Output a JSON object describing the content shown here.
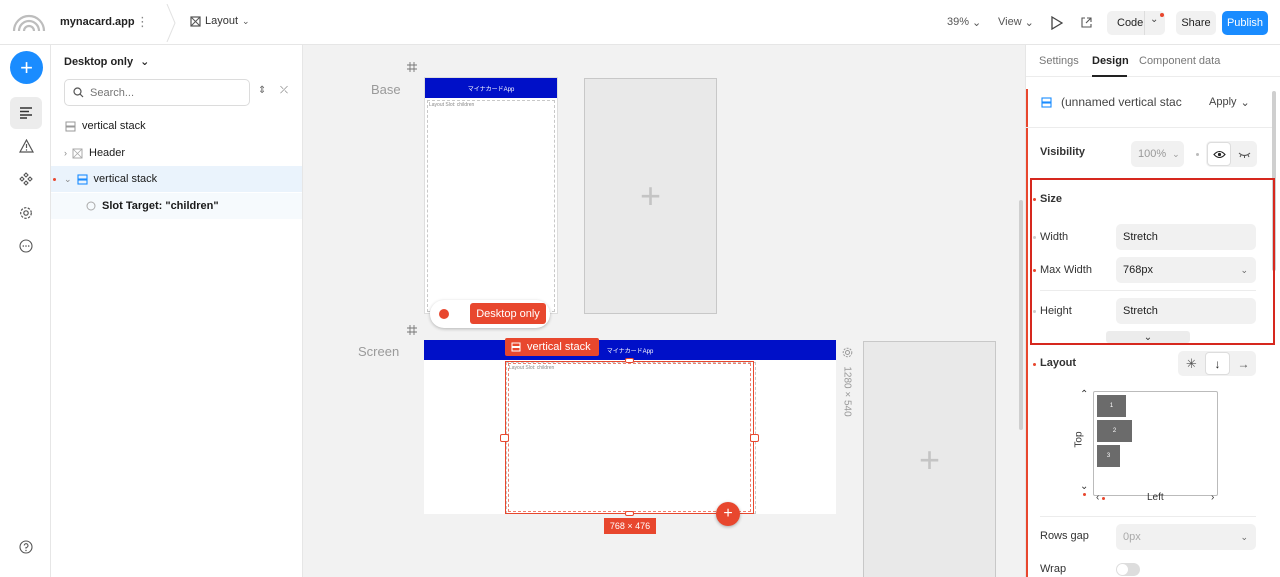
{
  "topbar": {
    "project_name": "mynacard.app",
    "layout_label": "Layout",
    "zoom": "39%",
    "view_label": "View",
    "code_label": "Code",
    "share_label": "Share",
    "publish_label": "Publish"
  },
  "layers": {
    "mode_label": "Desktop only",
    "search_placeholder": "Search...",
    "tree": [
      {
        "label": "vertical stack"
      },
      {
        "label": "Header"
      },
      {
        "label": "vertical stack"
      },
      {
        "label": "Slot Target: \"children\""
      }
    ]
  },
  "canvas": {
    "base_label": "Base",
    "screen_label": "Screen",
    "header_text": "マイナカードApp",
    "slot_text": "Layout Slot: children",
    "desktop_only_badge": "Desktop only",
    "selection_tag": "vertical stack",
    "selection_size": "768 × 476",
    "frame_size": "1280 × 540"
  },
  "right": {
    "tabs": [
      "Settings",
      "Design",
      "Component data"
    ],
    "active_tab": "Design",
    "component_title": "(unnamed vertical stac",
    "apply_label": "Apply",
    "visibility_label": "Visibility",
    "visibility_value": "100%",
    "size_label": "Size",
    "width_label": "Width",
    "width_value": "Stretch",
    "max_width_label": "Max Width",
    "max_width_value": "768px",
    "height_label": "Height",
    "height_value": "Stretch",
    "layout_label": "Layout",
    "layout_axis_v": "Top",
    "layout_axis_h": "Left",
    "layout_items": [
      "1",
      "2",
      "3"
    ],
    "rows_gap_label": "Rows gap",
    "rows_gap_placeholder": "0px",
    "wrap_label": "Wrap"
  },
  "colors": {
    "accent_blue": "#1a8cff",
    "publish_blue": "#1a8cff",
    "header_blue": "#0010c8",
    "selection_red": "#e8472e",
    "highlight_red": "#d6281e"
  }
}
